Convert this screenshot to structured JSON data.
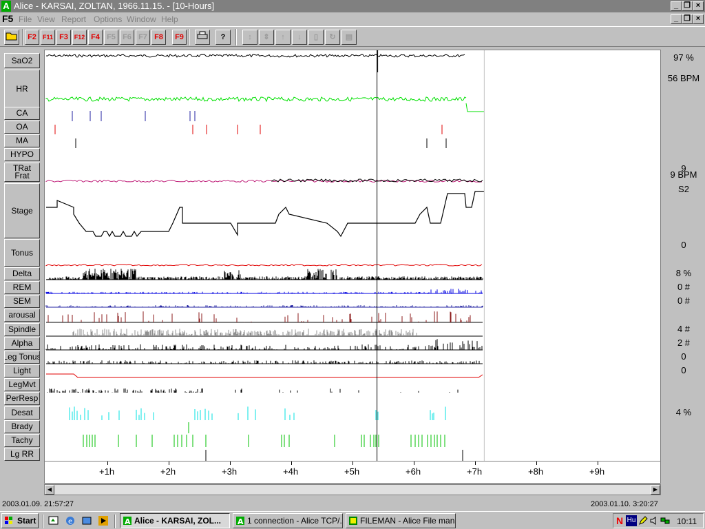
{
  "window": {
    "title": "Alice - KARSAI, ZOLTAN, 1966.11.15.  - [10-Hours]",
    "app_icon": "A"
  },
  "menubar": {
    "doc_label": "F5",
    "items": [
      "File",
      "View",
      "Report",
      "Options",
      "Window",
      "Help"
    ]
  },
  "toolbar": {
    "fkeys": [
      {
        "label": "F2",
        "state": "red"
      },
      {
        "label": "F11",
        "state": "red"
      },
      {
        "label": "F3",
        "state": "red"
      },
      {
        "label": "F12",
        "state": "red"
      },
      {
        "label": "F4",
        "state": "red"
      },
      {
        "label": "F5",
        "state": "gray"
      },
      {
        "label": "F6",
        "state": "gray"
      },
      {
        "label": "F7",
        "state": "gray"
      },
      {
        "label": "F8",
        "state": "red"
      },
      {
        "label": "F9",
        "state": "red"
      }
    ],
    "help_label": "?"
  },
  "channels": [
    {
      "label": "SaO2"
    },
    {
      "label": "HR"
    },
    {
      "label": "CA"
    },
    {
      "label": "OA"
    },
    {
      "label": "MA"
    },
    {
      "label": "HYPO"
    },
    {
      "label": "TRat Frat"
    },
    {
      "label": "Stage"
    },
    {
      "label": "Tonus"
    },
    {
      "label": "Delta"
    },
    {
      "label": "REM"
    },
    {
      "label": "SEM"
    },
    {
      "label": "arousal"
    },
    {
      "label": "Spindle"
    },
    {
      "label": "Alpha"
    },
    {
      "label": "Leg Tonus"
    },
    {
      "label": "Light"
    },
    {
      "label": "LegMvt"
    },
    {
      "label": "PerResp"
    },
    {
      "label": "Desat"
    },
    {
      "label": "Brady"
    },
    {
      "label": "Tachy"
    },
    {
      "label": "Lg RR"
    }
  ],
  "right_values": [
    {
      "channel": "SaO2",
      "text": "97 %"
    },
    {
      "channel": "HR",
      "text": "56 BPM"
    },
    {
      "channel": "TRat",
      "text": "9"
    },
    {
      "channel": "Frat",
      "text": "9 BPM"
    },
    {
      "channel": "Stage",
      "text": "S2"
    },
    {
      "channel": "Tonus",
      "text": "0"
    },
    {
      "channel": "Delta",
      "text": "8 %"
    },
    {
      "channel": "REM",
      "text": "0 #"
    },
    {
      "channel": "SEM",
      "text": "0 #"
    },
    {
      "channel": "Spindle",
      "text": "4 #"
    },
    {
      "channel": "Alpha",
      "text": "2 #"
    },
    {
      "channel": "Leg Tonus",
      "text": "0"
    },
    {
      "channel": "Light",
      "text": "0"
    },
    {
      "channel": "Desat",
      "text": "4 %"
    }
  ],
  "time_axis": {
    "ticks": [
      "+1h",
      "+2h",
      "+3h",
      "+4h",
      "+5h",
      "+6h",
      "+7h",
      "+8h",
      "+9h"
    ],
    "cursor_hours": 5.4,
    "data_end_hours": 7.15
  },
  "status": {
    "start_time": "2003.01.09. 21:57:27",
    "end_time": "2003.01.10. 3:20:27"
  },
  "taskbar": {
    "start_label": "Start",
    "tasks": [
      {
        "label": "Alice - KARSAI, ZOL...",
        "active": true,
        "icon": "alice-icon"
      },
      {
        "label": "1 connection  - Alice TCP/...",
        "active": false,
        "icon": "alice-icon"
      },
      {
        "label": "FILEMAN - Alice File mana...",
        "active": false,
        "icon": "fileman-icon"
      }
    ],
    "tray_lang": "Hu",
    "clock": "10:11"
  },
  "colors": {
    "hr_trace": "#00e000",
    "oa_marks": "#e00000",
    "ca_marks": "#2020a0",
    "tonus_trace": "#e00000",
    "rem_trace": "#0000e0",
    "arousal_marks": "#8b1a1a",
    "spindle_trace": "#909090",
    "desat_marks": "#00e0e0",
    "tachy_marks": "#00c000",
    "trat_trace": "#c0207a"
  }
}
